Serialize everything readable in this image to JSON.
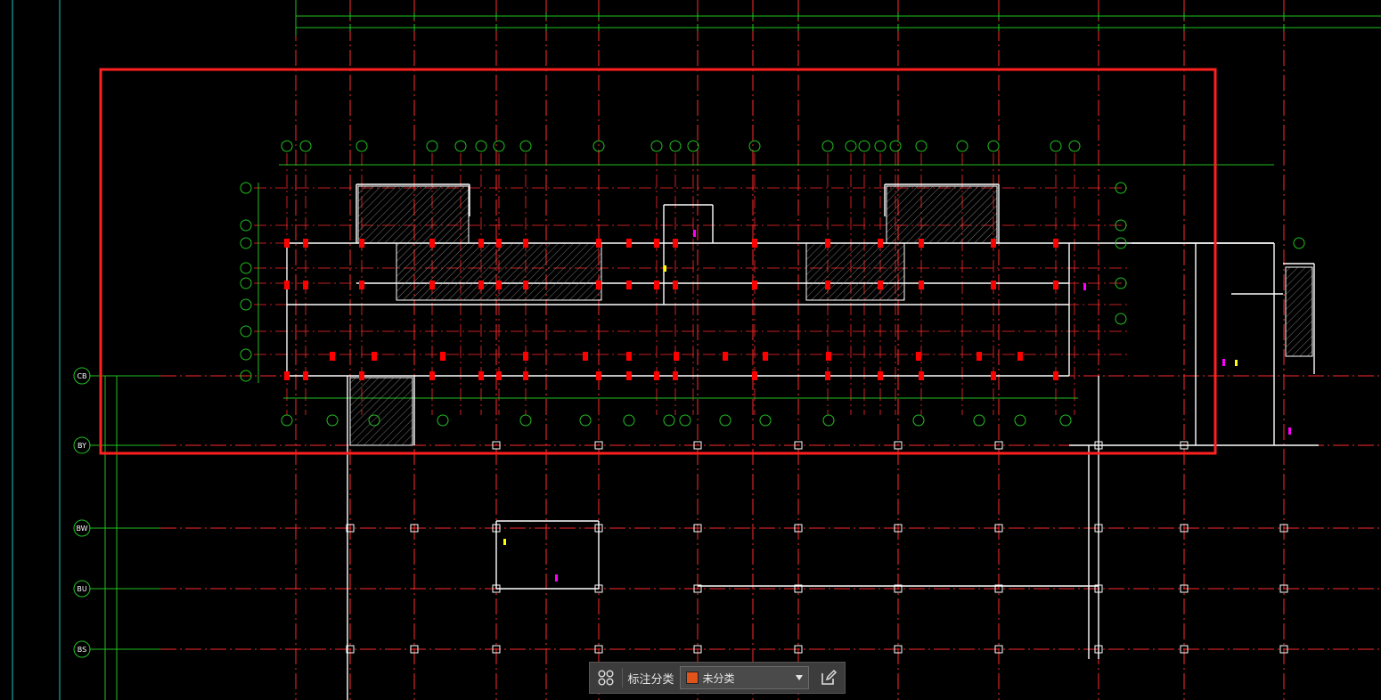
{
  "drawing": {
    "axis_labels": [
      "CB",
      "BY",
      "BW",
      "BU",
      "BS"
    ],
    "colors": {
      "background": "#000000",
      "grid_line": "#ff2a2a",
      "dimension": "#22c022",
      "wall": "#ffffff",
      "column": "#ff0000",
      "selection": "#ff2020",
      "cyan": "#19c6c6",
      "magenta": "#ff00ff",
      "yellow": "#ffff00"
    }
  },
  "toolbar": {
    "grid_icon": "grid-four-circles-icon",
    "label": "标注分类",
    "category_value": "未分类",
    "category_color": "#e0531b",
    "dropdown_icon": "chevron-down-icon",
    "edit_icon": "edit-pencil-icon"
  }
}
